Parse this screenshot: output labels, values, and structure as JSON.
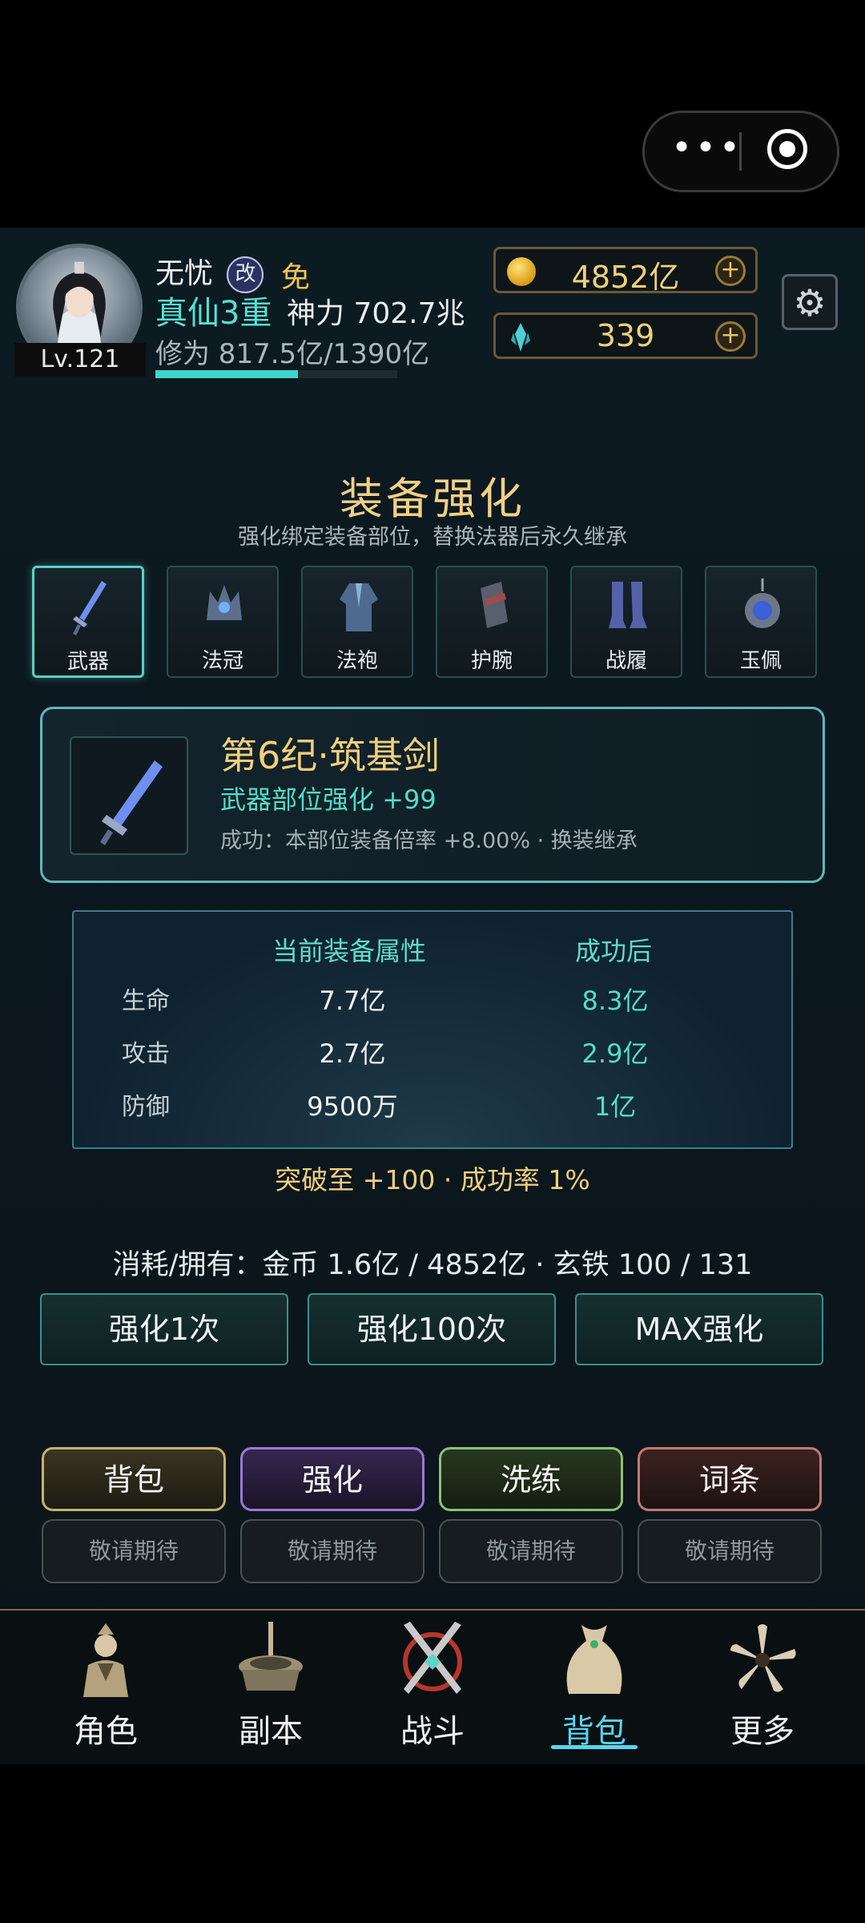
{
  "capsule": {
    "more_icon": "ellipsis-icon",
    "close_icon": "target-icon",
    "dots": "•••"
  },
  "player": {
    "level": "Lv.121",
    "name": "无忧",
    "badge1": "改",
    "badge2": "免",
    "realm": "真仙3重",
    "power": "神力 702.7兆",
    "cultivation": "修为 817.5亿/1390亿",
    "cultivation_progress": 0.588
  },
  "currency": {
    "gold": "4852亿",
    "gem": "339",
    "plus": "+"
  },
  "settings_icon": "⚙",
  "page": {
    "title": "装备强化",
    "subtitle": "强化绑定装备部位，替换法器后永久继承"
  },
  "slots": [
    {
      "label": "武器",
      "icon": "sword-icon"
    },
    {
      "label": "法冠",
      "icon": "crown-icon"
    },
    {
      "label": "法袍",
      "icon": "robe-icon"
    },
    {
      "label": "护腕",
      "icon": "bracer-icon"
    },
    {
      "label": "战履",
      "icon": "boots-icon"
    },
    {
      "label": "玉佩",
      "icon": "pendant-icon"
    }
  ],
  "item": {
    "name": "第6纪·筑基剑",
    "enhance": "武器部位强化 +99",
    "desc": "成功：本部位装备倍率 +8.00% · 换装继承"
  },
  "stats": {
    "header_current": "当前装备属性",
    "header_after": "成功后",
    "rows": [
      {
        "label": "生命",
        "current": "7.7亿",
        "after": "8.3亿"
      },
      {
        "label": "攻击",
        "current": "2.7亿",
        "after": "2.9亿"
      },
      {
        "label": "防御",
        "current": "9500万",
        "after": "1亿"
      }
    ]
  },
  "breakthrough": "突破至 +100 · 成功率 1%",
  "cost": "消耗/拥有：金币 1.6亿 / 4852亿 · 玄铁 100 / 131",
  "actions": {
    "once": "强化1次",
    "hundred": "强化100次",
    "max": "MAX强化"
  },
  "tabs": [
    {
      "label": "背包",
      "sub": "敬请期待",
      "color": "#c9b070"
    },
    {
      "label": "强化",
      "sub": "敬请期待",
      "color": "#9a78d6"
    },
    {
      "label": "洗练",
      "sub": "敬请期待",
      "color": "#8dc07a"
    },
    {
      "label": "词条",
      "sub": "敬请期待",
      "color": "#c27a70"
    }
  ],
  "nav": [
    {
      "label": "角色",
      "icon": "character-icon"
    },
    {
      "label": "副本",
      "icon": "dungeon-icon"
    },
    {
      "label": "战斗",
      "icon": "crossed-swords-icon"
    },
    {
      "label": "背包",
      "icon": "bag-icon",
      "active": true
    },
    {
      "label": "更多",
      "icon": "more-flower-icon"
    }
  ]
}
